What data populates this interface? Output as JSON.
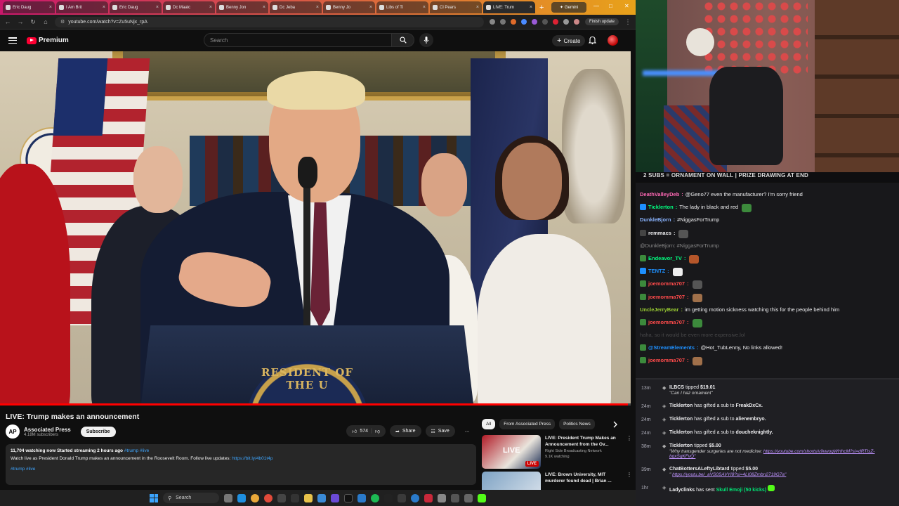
{
  "browser": {
    "tabs": [
      {
        "label": "Eric Daug",
        "active": false
      },
      {
        "label": "I Am Brit",
        "active": false
      },
      {
        "label": "Eric Daug",
        "active": false
      },
      {
        "label": "Dc Maalc",
        "active": false
      },
      {
        "label": "Benny Jon",
        "active": false
      },
      {
        "label": "Dc Jeba",
        "active": false
      },
      {
        "label": "Benny Jo",
        "active": false
      },
      {
        "label": "Libs of Ti",
        "active": false
      },
      {
        "label": "Cl Pears",
        "active": false
      },
      {
        "label": "LIVE: Trum",
        "active": true
      }
    ],
    "gemini_tab": "Gemini",
    "url": "youtube.com/watch?v=Zu5uNjx_rpA",
    "finish_update": "Finish update"
  },
  "youtube": {
    "logo_text": "Premium",
    "search_placeholder": "Search",
    "create_label": "Create",
    "video": {
      "seal_text": "RESIDENT OF THE U",
      "progress_fraction": 0.995
    },
    "title": "LIVE: Trump makes an announcement",
    "channel": {
      "logo": "AP",
      "name": "Associated Press",
      "subs": "4.18M subscribers"
    },
    "subscribe_label": "Subscribe",
    "likes": "574",
    "share_label": "Share",
    "save_label": "Save",
    "description": {
      "stats": "11,704 watching now  Started streaming 2 hours ago",
      "stats_tags": "#trump #live",
      "line": "Watch live as President Donald Trump makes an announcement in the Roosevelt Room. Follow live updates:",
      "link": "https://bit.ly/4b01t4p",
      "tags": "#trump #live"
    },
    "chips": [
      "All",
      "From Associated Press",
      "Politics News"
    ],
    "recommendations": [
      {
        "title": "LIVE: President Trump Makes an Announcement from the Ov...",
        "channel": "Right Side Broadcasting Network",
        "meta": "9.1K watching",
        "badge": "LIVE",
        "thumb_text": "LIVE"
      },
      {
        "title": "LIVE: Brown University, MIT murderer found dead | Brian ...",
        "channel": "",
        "meta": "",
        "badge": "",
        "thumb_text": ""
      }
    ]
  },
  "stream": {
    "banner": "2 SUBS = ORNAMENT ON WALL | PRIZE DRAWING AT END",
    "chat": [
      {
        "user": "DeathValleyDeb",
        "color": "#ff69b4",
        "text": "@Geno77 even the manufacturer? I'm sorry friend",
        "badge": ""
      },
      {
        "user": "Ticklerton",
        "color": "#00ff7f",
        "text": "The lady in black and red",
        "badge": "#1e90ff",
        "emote": "#3c8a3c"
      },
      {
        "user": "DunkleBjorn",
        "color": "#8ab4ff",
        "text": "#NiggasForTrump",
        "badge": ""
      },
      {
        "user": "remmacs",
        "color": "#efeff1",
        "text": "",
        "badge": "#444",
        "emote": "#555"
      },
      {
        "user": "",
        "color": "#888",
        "text": "@DunkleBjorn: #NiggasForTrump",
        "badge": "",
        "reply": true
      },
      {
        "user": "Endeavor_TV",
        "color": "#00ff7f",
        "text": "",
        "badge": "#3c8a3c",
        "emote": "#b5562a"
      },
      {
        "user": "TENTZ",
        "color": "#1e90ff",
        "text": "",
        "badge": "#1e90ff",
        "emote": "#eee"
      },
      {
        "user": "joemomma707",
        "color": "#ff4b4b",
        "text": "",
        "badge": "#3c8a3c",
        "emote": "#555"
      },
      {
        "user": "joemomma707",
        "color": "#ff4b4b",
        "text": "",
        "badge": "#3c8a3c",
        "emote": "#a0704a"
      },
      {
        "user": "UncleJerryBear",
        "color": "#9acd32",
        "text": "im getting motion sickness watching this for the people behind him",
        "badge": ""
      },
      {
        "user": "joemomma707",
        "color": "#ff4b4b",
        "text": "",
        "badge": "#3c8a3c",
        "emote": "#3c8a3c"
      },
      {
        "user": "",
        "color": "#777",
        "text": "haha, so it would be even more expensive.lol",
        "badge": "",
        "dim": true
      },
      {
        "user": "@StreamElements",
        "color": "#1e90ff",
        "text": "@Hot_TubLenny, No links allowed!",
        "badge": "#3c8a3c"
      },
      {
        "user": "joemomma707",
        "color": "#ff4b4b",
        "text": "",
        "badge": "#3c8a3c",
        "emote": "#a0704a"
      }
    ],
    "events": [
      {
        "time": "13m",
        "icon": "tip",
        "user": "ILBCS",
        "action": "tipped",
        "amount": "$19.01",
        "sub": "\"Can I haz ornament\"",
        "link": ""
      },
      {
        "time": "24m",
        "icon": "gift",
        "user": "Ticklerton",
        "action": "has gifted a sub to",
        "target": "FreakDxCx.",
        "sub": "",
        "link": ""
      },
      {
        "time": "24m",
        "icon": "gift",
        "user": "Ticklerton",
        "action": "has gifted a sub to",
        "target": "alienembryo.",
        "sub": "",
        "link": ""
      },
      {
        "time": "24m",
        "icon": "gift",
        "user": "Ticklerton",
        "action": "has gifted a sub to",
        "target": "doucheknightly.",
        "sub": "",
        "link": ""
      },
      {
        "time": "38m",
        "icon": "tip",
        "user": "Ticklerton",
        "action": "tipped",
        "amount": "$5.00",
        "sub": "\"Why transgender surgeries are not medicine:",
        "link": "https://youtube.com/shorts/v9vwoqWHhcM?si=dRTIsZ-bgxSgKFvQ\""
      },
      {
        "time": "39m",
        "icon": "tip",
        "user": "ChatBottersALeftyLibtard",
        "action": "tipped",
        "amount": "$5.00",
        "sub": "\"",
        "link": "https://youtu.be/_aVS0SAVYI8?si=4LI08Zmbn2719G7a\""
      },
      {
        "time": "1hr",
        "icon": "gift",
        "user": "Ladyclinks",
        "action": "has sent",
        "amount": "Skull Emoji (50 kicks)",
        "sub": "",
        "link": ""
      }
    ]
  },
  "taskbar": {
    "search_label": "Search"
  }
}
